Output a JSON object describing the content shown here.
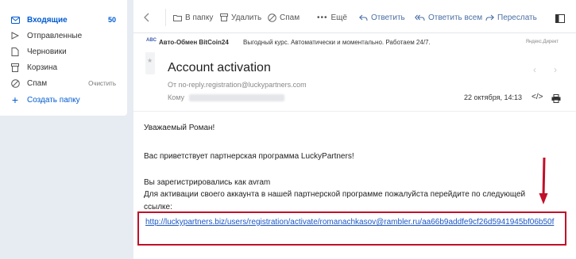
{
  "sidebar": {
    "items": [
      {
        "icon": "envelope-icon",
        "label": "Входящие",
        "count": "50"
      },
      {
        "icon": "send-icon",
        "label": "Отправленные"
      },
      {
        "icon": "draft-icon",
        "label": "Черновики"
      },
      {
        "icon": "trash-icon",
        "label": "Корзина"
      },
      {
        "icon": "spam-icon",
        "label": "Спам",
        "action": "Очистить"
      },
      {
        "icon": "plus-icon",
        "label": "Создать папку"
      }
    ]
  },
  "toolbar": {
    "to_folder": "В папку",
    "delete": "Удалить",
    "spam": "Спам",
    "more": "Ещё",
    "reply": "Ответить",
    "reply_all": "Ответить всем",
    "forward": "Переслать"
  },
  "ad": {
    "logo": "ABC",
    "title": "Авто-Обмен BitCoin24",
    "text": "Выгодный курс. Автоматически и моментально. Работаем 24/7.",
    "label": "Яндекс.Директ"
  },
  "message": {
    "subject": "Account activation",
    "from_label": "От",
    "from_address": "no-reply.registration@luckypartners.com",
    "to_label": "Кому",
    "date": "22 октября, 14:13",
    "greeting": "Уважаемый Роман!",
    "welcome": "Вас приветствует партнерская программа LuckyPartners!",
    "registered": "Вы зарегистрировались как avram",
    "instruction_1": "Для активации своего аккаунта в нашей партнерской программе пожалуйста перейдите по следующей",
    "instruction_2": "ссылке:",
    "link": "http://luckypartners.biz/users/registration/activate/romanachkasov@rambler.ru/aa66b9addfe9cf26d5941945bf06b50f"
  },
  "colors": {
    "accent": "#005bd1",
    "highlight_box": "#c0102a",
    "link": "#1a57c4"
  }
}
